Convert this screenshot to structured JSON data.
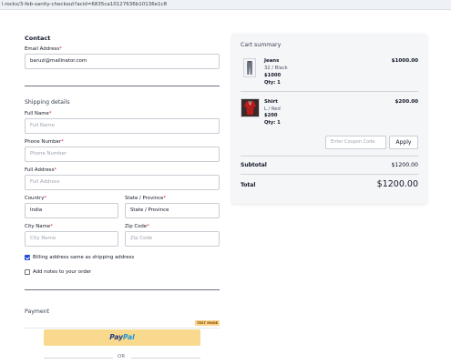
{
  "browser": {
    "url": "l.rocks/3-feb-sanity-checkout?acid=6835ca10127636b10136e1c8"
  },
  "contact": {
    "title": "Contact",
    "email_label": "Email Address",
    "email_value": "baruzi@mailinator.com"
  },
  "shipping": {
    "title": "Shipping details",
    "full_name_label": "Full Name",
    "full_name_placeholder": "Full Name",
    "phone_label": "Phone Number",
    "phone_placeholder": "Phone Number",
    "address_label": "Full Address",
    "address_placeholder": "Full Address",
    "country_label": "Country",
    "country_value": "India",
    "state_label": "State / Province",
    "state_placeholder": "State / Province",
    "city_label": "City Name",
    "city_placeholder": "City Name",
    "zip_label": "Zip Code",
    "zip_placeholder": "Zip Code",
    "billing_same_label": "Billing address same as shipping address",
    "billing_same_checked": true,
    "notes_label": "Add notes to your order",
    "notes_checked": false
  },
  "payment": {
    "title": "Payment",
    "test_badge": "TEST MODE",
    "paypal_pay": "Pay",
    "paypal_pal": "Pal",
    "or_text": "OR"
  },
  "cart": {
    "title": "Cart summary",
    "items": [
      {
        "name": "Jeans",
        "variant": "32 / Black",
        "price": "$1000",
        "qty": "Qty: 1",
        "line_total": "$1000.00",
        "thumb_icon": "jeans-icon"
      },
      {
        "name": "Shirt",
        "variant": "L / Red",
        "price": "$200",
        "qty": "Qty: 1",
        "line_total": "$200.00",
        "thumb_icon": "shirt-icon"
      }
    ],
    "coupon_placeholder": "Enter Coupon Code",
    "apply_label": "Apply",
    "subtotal_label": "Subtotal",
    "subtotal_value": "$1200.00",
    "total_label": "Total",
    "total_value": "$1200.00"
  }
}
